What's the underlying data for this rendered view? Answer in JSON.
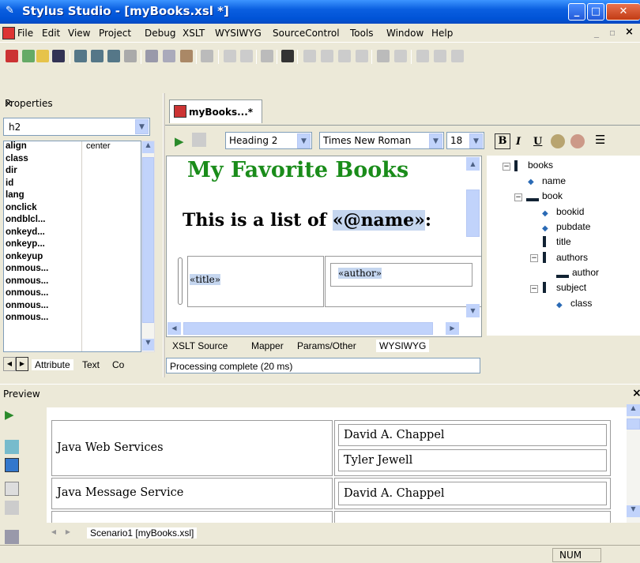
{
  "window": {
    "title": "Stylus Studio - [myBooks.xsl *]"
  },
  "menu": [
    "File",
    "Edit",
    "View",
    "Project",
    "Debug",
    "XSLT",
    "WYSIWYG",
    "SourceControl",
    "Tools",
    "Window",
    "Help"
  ],
  "properties": {
    "title": "Properties",
    "selected_element": "h2",
    "rows": [
      {
        "name": "align",
        "value": "center"
      },
      {
        "name": "class",
        "value": ""
      },
      {
        "name": "dir",
        "value": ""
      },
      {
        "name": "id",
        "value": ""
      },
      {
        "name": "lang",
        "value": ""
      },
      {
        "name": "onclick",
        "value": ""
      },
      {
        "name": "ondblcl...",
        "value": ""
      },
      {
        "name": "onkeyd...",
        "value": ""
      },
      {
        "name": "onkeyp...",
        "value": ""
      },
      {
        "name": "onkeyup",
        "value": ""
      },
      {
        "name": "onmous...",
        "value": ""
      },
      {
        "name": "onmous...",
        "value": ""
      },
      {
        "name": "onmous...",
        "value": ""
      },
      {
        "name": "onmous...",
        "value": ""
      },
      {
        "name": "onmous...",
        "value": ""
      }
    ],
    "tabs": [
      "Attribute",
      "Text",
      "Co"
    ]
  },
  "editor": {
    "tab_label": "myBooks...*",
    "style_select": "Heading 2",
    "font_select": "Times New Roman",
    "size_select": "18",
    "heading": "My Favorite Books",
    "para_prefix": "This is a list of ",
    "para_field": "«@name»",
    "para_suffix": ":",
    "cell_title": "«title»",
    "cell_author": "«author»",
    "tree": [
      "books",
      "name",
      "book",
      "bookid",
      "pubdate",
      "title",
      "authors",
      "author",
      "subject",
      "class"
    ],
    "bottom_tabs": [
      "XSLT Source",
      "Mapper",
      "Params/Other",
      "WYSIWYG"
    ],
    "status": "Processing complete  (20 ms)"
  },
  "preview": {
    "title": "Preview",
    "rows": [
      {
        "title": "Java Web Services",
        "authors": [
          "David A. Chappel",
          "Tyler Jewell"
        ]
      },
      {
        "title": "Java Message Service",
        "authors": [
          "David A. Chappel"
        ]
      }
    ],
    "tab": "Scenario1 [myBooks.xsl]"
  },
  "statusbar": {
    "num": "NUM"
  }
}
